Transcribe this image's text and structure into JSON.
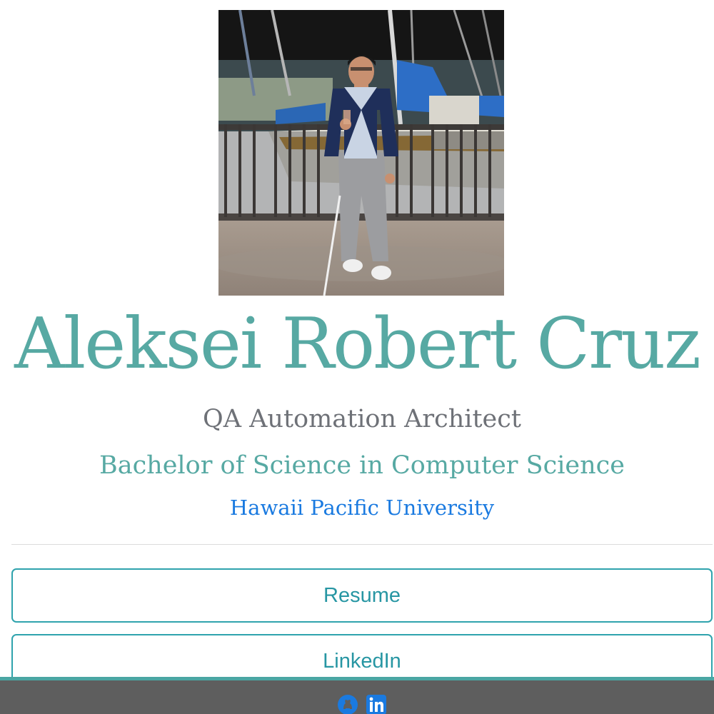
{
  "profile": {
    "name": "Aleksei Robert Cruz",
    "title": "QA Automation Architect",
    "degree": "Bachelor of Science in Computer Science",
    "university": "Hawaii Pacific University"
  },
  "buttons": {
    "resume_label": "Resume",
    "linkedin_label": "LinkedIn"
  },
  "footer": {
    "icons": [
      "github-icon",
      "linkedin-icon"
    ]
  },
  "colors": {
    "accent": "#57a9a3",
    "button_border": "#2fa3ad",
    "link": "#1a7ae0",
    "subtitle": "#6e7177",
    "footer_bg": "#5e5e5e",
    "footer_border": "#4aa6a3"
  }
}
